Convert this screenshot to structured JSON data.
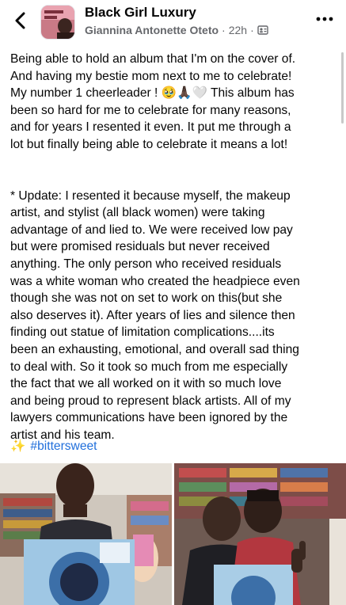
{
  "header": {
    "group_name": "Black Girl Luxury",
    "author": "Giannina Antonette Oteto",
    "time": "22h",
    "separator": "·"
  },
  "post": {
    "paragraph1_lines": [
      "Being able to hold an album that I'm on the cover of.",
      "And having my bestie mom next to me to celebrate!",
      "My number 1 cheerleader ! 🥹🙏🏿🤍 This album has",
      "been so hard for me to celebrate for many reasons,",
      "and for years I resented it even. It put me through a",
      "lot but finally being able to celebrate it means a lot!"
    ],
    "paragraph2_lines": [
      "* Update: I resented it because myself, the makeup",
      "artist, and stylist (all black women) were taking",
      "advantage of and lied to. We were received low pay",
      "but were promised residuals but never received",
      "anything. The only person who received residuals",
      "was a white woman who created the headpiece even",
      "though she was not on set to work on this(but she",
      "also deserves it). After years of lies and silence then",
      "finding out statue of limitation complications....its",
      "been an exhausting, emotional, and overall sad thing",
      "to deal with. So it took so much from me especially",
      "the fact that we all worked on it with so much love",
      "and being proud to represent black artists. All of my",
      "lawyers communications have been ignored by the",
      "artist and his team."
    ],
    "hashtag_emoji": "✨",
    "hashtag": "#bittersweet"
  },
  "icons": {
    "back": "chevron-left-icon",
    "more": "more-horizontal-icon",
    "privacy": "group-privacy-icon"
  },
  "colors": {
    "link": "#216fdb",
    "secondary_text": "#65676b"
  }
}
